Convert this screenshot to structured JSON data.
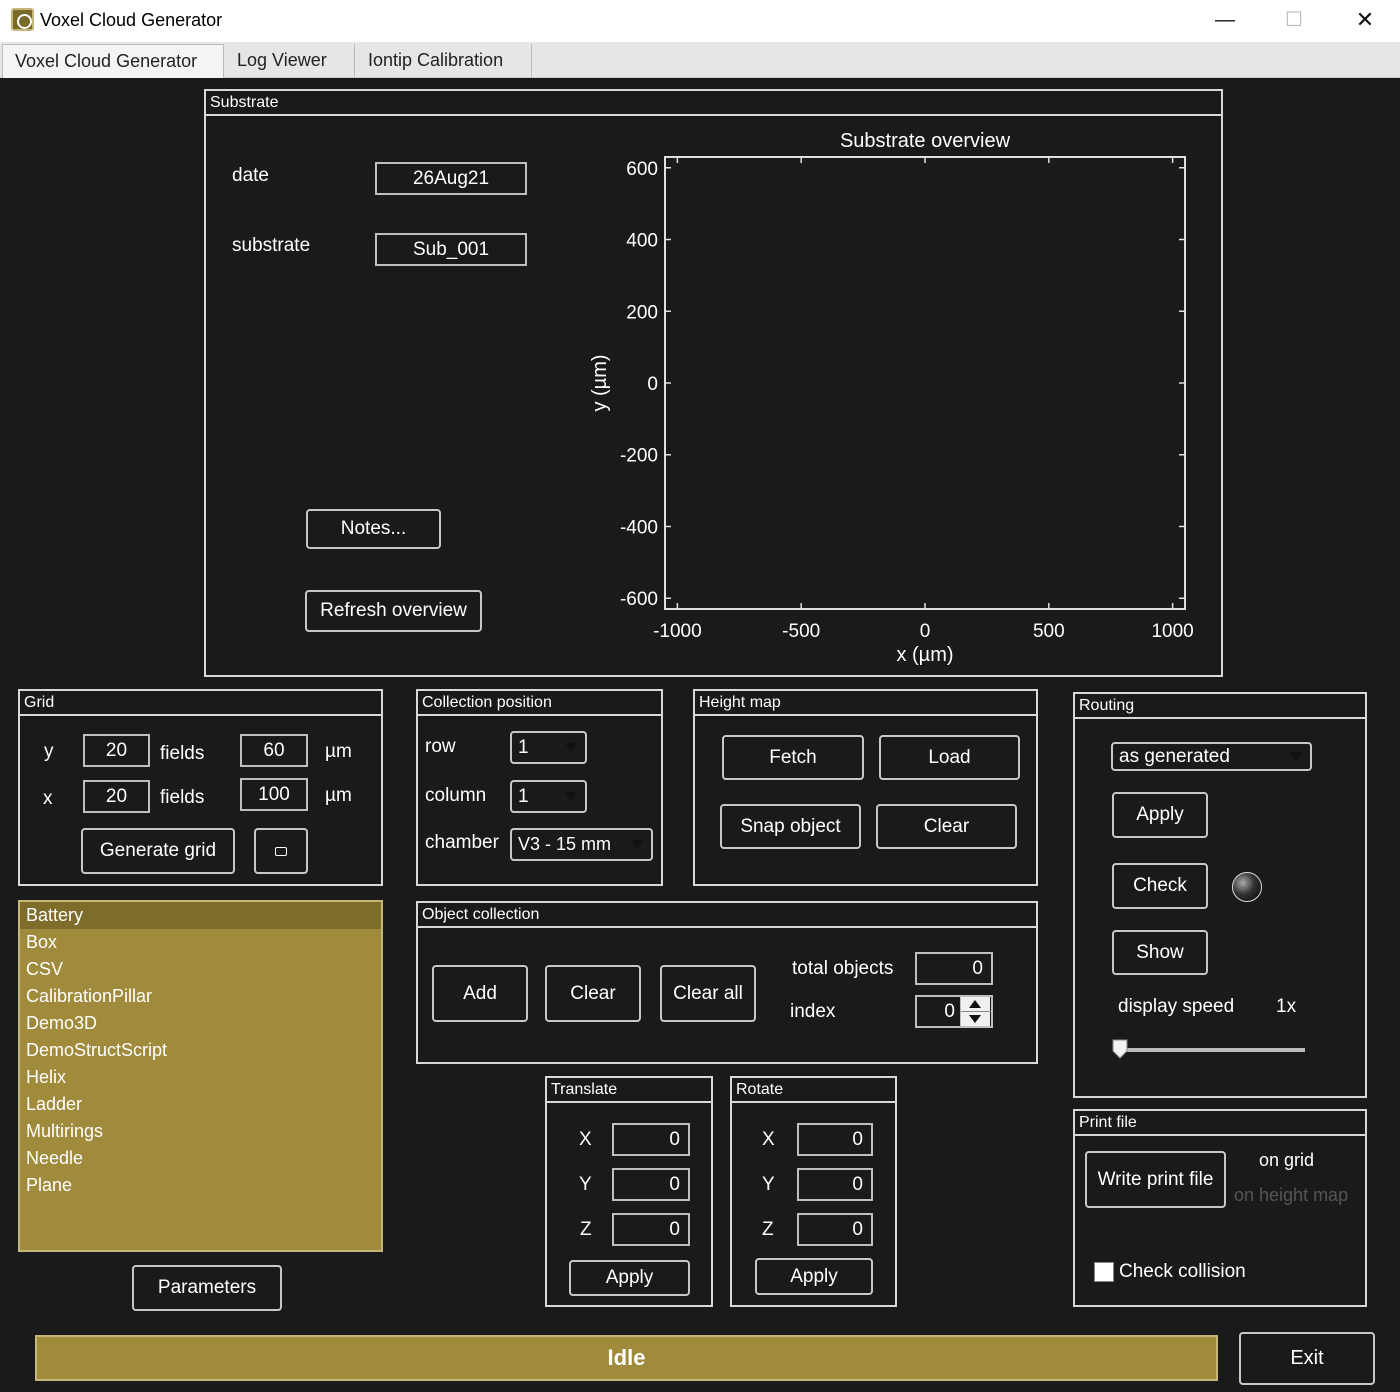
{
  "window": {
    "title": "Voxel Cloud Generator",
    "minimize": "—",
    "maximize": "☐",
    "close": "✕"
  },
  "tabs": [
    {
      "label": "Voxel Cloud Generator",
      "active": true
    },
    {
      "label": "Log Viewer",
      "active": false
    },
    {
      "label": "Iontip Calibration",
      "active": false
    }
  ],
  "substrate": {
    "title": "Substrate",
    "date_label": "date",
    "date_value": "26Aug21",
    "substrate_label": "substrate",
    "substrate_value": "Sub_001",
    "notes_button": "Notes...",
    "refresh_button": "Refresh overview"
  },
  "chart_data": {
    "type": "scatter",
    "title": "Substrate overview",
    "xlabel": "x  (µm)",
    "ylabel": "y  (µm)",
    "xlim": [
      -1050,
      1050
    ],
    "ylim": [
      -630,
      630
    ],
    "xticks": [
      -1000,
      -500,
      0,
      500,
      1000
    ],
    "yticks": [
      600,
      400,
      200,
      0,
      -200,
      -400,
      -600
    ],
    "series": [],
    "grid": false
  },
  "grid": {
    "title": "Grid",
    "y_label": "y",
    "y_fields": "20",
    "y_fields_label": "fields",
    "y_pitch": "60",
    "y_unit": "µm",
    "x_label": "x",
    "x_fields": "20",
    "x_fields_label": "fields",
    "x_pitch": "100",
    "x_unit": "µm",
    "generate_button": "Generate grid",
    "extra_button_icon": "grid-small-icon"
  },
  "collection_position": {
    "title": "Collection position",
    "row_label": "row",
    "row_value": "1",
    "column_label": "column",
    "column_value": "1",
    "chamber_label": "chamber",
    "chamber_value": "V3 - 15 mm"
  },
  "height_map": {
    "title": "Height map",
    "fetch": "Fetch",
    "load": "Load",
    "snap": "Snap object",
    "clear": "Clear"
  },
  "routing": {
    "title": "Routing",
    "mode": "as generated",
    "apply": "Apply",
    "check": "Check",
    "show": "Show",
    "display_speed_label": "display speed",
    "display_speed_value": "1x",
    "speed_slider": 0.0,
    "status_color": "#333333"
  },
  "object_list": {
    "items": [
      "Battery",
      "Box",
      "CSV",
      "CalibrationPillar",
      "Demo3D",
      "DemoStructScript",
      "Helix",
      "Ladder",
      "Multirings",
      "Needle",
      "Plane"
    ],
    "selected": "Battery"
  },
  "parameters_button": "Parameters",
  "object_collection": {
    "title": "Object collection",
    "add": "Add",
    "clear": "Clear",
    "clear_all": "Clear all",
    "total_label": "total objects",
    "total_value": "0",
    "index_label": "index",
    "index_value": "0"
  },
  "translate": {
    "title": "Translate",
    "x_label": "X",
    "x": "0",
    "y_label": "Y",
    "y": "0",
    "z_label": "Z",
    "z": "0",
    "apply": "Apply"
  },
  "rotate": {
    "title": "Rotate",
    "x_label": "X",
    "x": "0",
    "y_label": "Y",
    "y": "0",
    "z_label": "Z",
    "z": "0",
    "apply": "Apply"
  },
  "print_file": {
    "title": "Print file",
    "write_button": "Write print file",
    "on_grid": "on grid",
    "on_height_map": "on  height map",
    "check_collision": "Check collision",
    "check_collision_checked": false
  },
  "status": {
    "text": "Idle"
  },
  "exit_button": "Exit",
  "colors": {
    "accent": "#a08a3c",
    "background": "#1a1a1a",
    "disabled_text": "#555555"
  }
}
